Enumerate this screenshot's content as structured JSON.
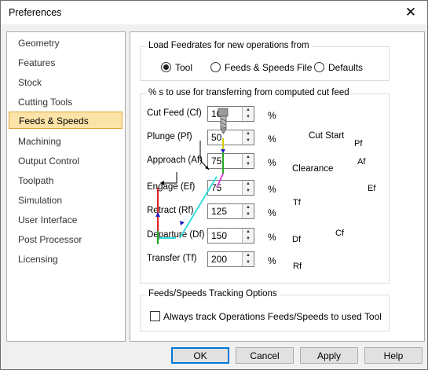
{
  "window": {
    "title": "Preferences",
    "close_icon": "close-icon"
  },
  "sidebar": {
    "items": [
      {
        "label": "Geometry"
      },
      {
        "label": "Features"
      },
      {
        "label": "Stock"
      },
      {
        "label": "Cutting Tools"
      },
      {
        "label": "Feeds & Speeds",
        "selected": true
      },
      {
        "label": "Machining"
      },
      {
        "label": "Output Control"
      },
      {
        "label": "Toolpath"
      },
      {
        "label": "Simulation"
      },
      {
        "label": "User Interface"
      },
      {
        "label": "Post Processor"
      },
      {
        "label": "Licensing"
      }
    ]
  },
  "load_group": {
    "title": "Load Feedrates for new operations from",
    "options": [
      {
        "label": "Tool",
        "checked": true
      },
      {
        "label": "Feeds & Speeds File",
        "checked": false
      },
      {
        "label": "Defaults",
        "checked": false
      }
    ]
  },
  "pct_group": {
    "title": "% s to use for transferring from computed cut feed",
    "fields": [
      {
        "label": "Cut Feed (Cf)",
        "value": "100",
        "unit": "%"
      },
      {
        "label": "Plunge (Pf)",
        "value": "50",
        "unit": "%"
      },
      {
        "label": "Approach (Af)",
        "value": "75",
        "unit": "%"
      },
      {
        "label": "Engage (Ef)",
        "value": "75",
        "unit": "%"
      },
      {
        "label": "Retract (Rf)",
        "value": "125",
        "unit": "%"
      },
      {
        "label": "Departure (Df)",
        "value": "150",
        "unit": "%"
      },
      {
        "label": "Transfer (Tf)",
        "value": "200",
        "unit": "%"
      }
    ],
    "diagram": {
      "cut_start": "Cut Start",
      "clearance": "Clearance",
      "pf": "Pf",
      "af": "Af",
      "ef": "Ef",
      "cf": "Cf",
      "rf": "Rf",
      "df": "Df",
      "tf": "Tf"
    }
  },
  "tracking_group": {
    "title": "Feeds/Speeds Tracking Options",
    "checkbox_label": "Always track Operations Feeds/Speeds to used Tool",
    "checked": false
  },
  "buttons": {
    "ok": "OK",
    "cancel": "Cancel",
    "apply": "Apply",
    "help": "Help"
  }
}
